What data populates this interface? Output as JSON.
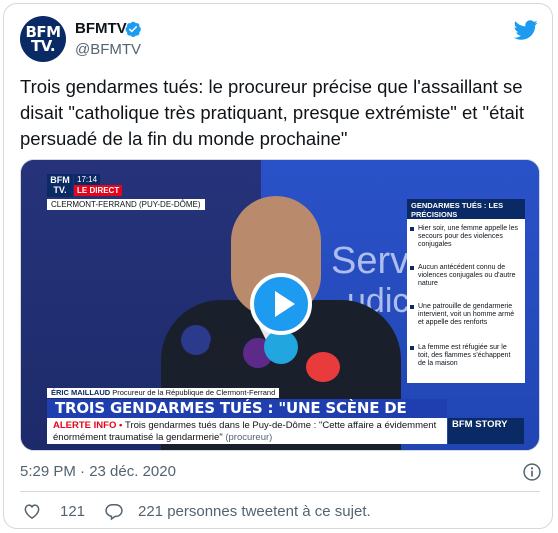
{
  "account": {
    "name": "BFMTV",
    "handle": "@BFMTV",
    "avatar_line1": "BFM",
    "avatar_line2": "TV."
  },
  "tweet": {
    "text": "Trois gendarmes tués: le procureur précise que l'assaillant se disait \"catholique très pratiquant, presque extrémiste\" et \"était persuadé de la fin du monde prochaine\""
  },
  "video": {
    "bug_line1": "BFM",
    "bug_line2": "TV.",
    "time": "17:14",
    "live_label": "LE DIRECT",
    "location": "CLERMONT-FERRAND (PUY-DE-DÔME)",
    "wall_text_1": "Serv",
    "wall_text_2": "udici",
    "side_title": "GENDARMES TUÉS : LES PRÉCISIONS",
    "side_items": [
      "Hier soir, une femme appelle les secours pour des violences conjugales",
      "Aucun antécédent connu de violences conjugales ou d'autre nature",
      "Une patrouille de gendarmerie intervient, voit un homme armé et appelle des renforts",
      "La femme est réfugiée sur le toit, des flammes s'échappent de la maison"
    ],
    "speaker_name": "ÉRIC MAILLAUD",
    "speaker_role": "Procureur de la République de Clermont-Ferrand",
    "headline": "TROIS GENDARMES TUÉS : \"UNE SCÈNE DE GUERRE\"",
    "ticker_label": "ALERTE INFO •",
    "ticker_text": "Trois gendarmes tués dans le Puy-de-Dôme : \"Cette affaire a évidemment énormément traumatisé la gendarmerie\"",
    "ticker_source": "(procureur)",
    "story_label": "BFM STORY"
  },
  "meta": {
    "timestamp": "5:29 PM · 23 déc. 2020"
  },
  "actions": {
    "like_count": "121",
    "retweet_text": "221 personnes tweetent à ce sujet."
  },
  "colors": {
    "twitter_blue": "#1d9bf0",
    "bfm_navy": "#0a2a66",
    "bfm_red": "#e3051b"
  }
}
